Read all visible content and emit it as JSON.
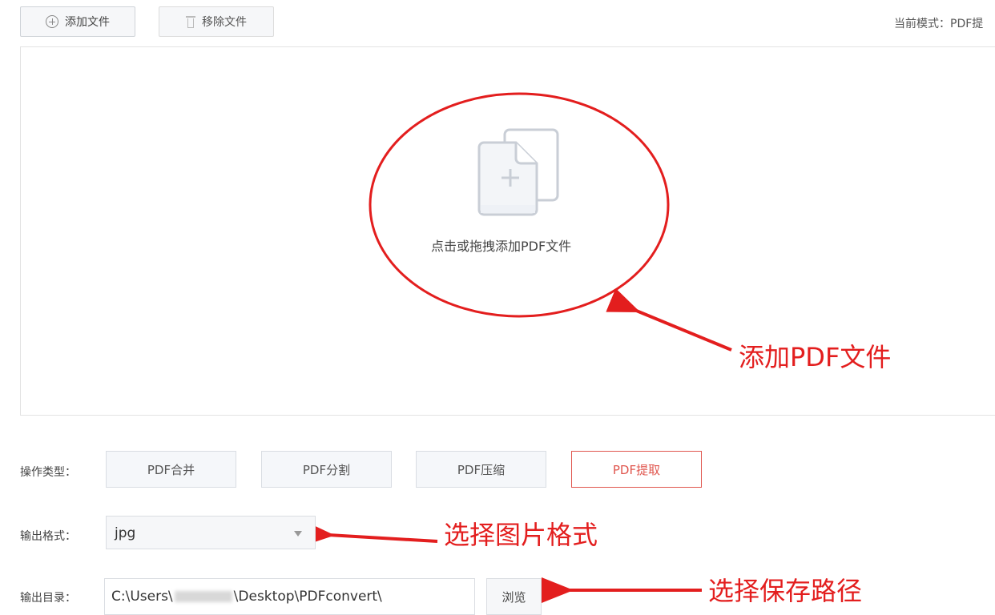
{
  "toolbar": {
    "add_label": "添加文件",
    "remove_label": "移除文件",
    "mode_text": "当前模式：PDF提"
  },
  "dropzone": {
    "hint": "点击或拖拽添加PDF文件"
  },
  "annotations": {
    "add_pdf": "添加PDF文件",
    "choose_format": "选择图片格式",
    "choose_path": "选择保存路径",
    "color": "#e31e1e"
  },
  "operation": {
    "label": "操作类型：",
    "buttons": [
      "PDF合并",
      "PDF分割",
      "PDF压缩",
      "PDF提取"
    ],
    "selected": "PDF提取"
  },
  "output_format": {
    "label": "输出格式：",
    "value": "jpg"
  },
  "output_dir": {
    "label": "输出目录：",
    "path_prefix": "C:\\Users\\",
    "path_suffix": "\\Desktop\\PDFconvert\\",
    "browse_label": "浏览"
  },
  "colors": {
    "accent_selected": "#e0574f"
  }
}
